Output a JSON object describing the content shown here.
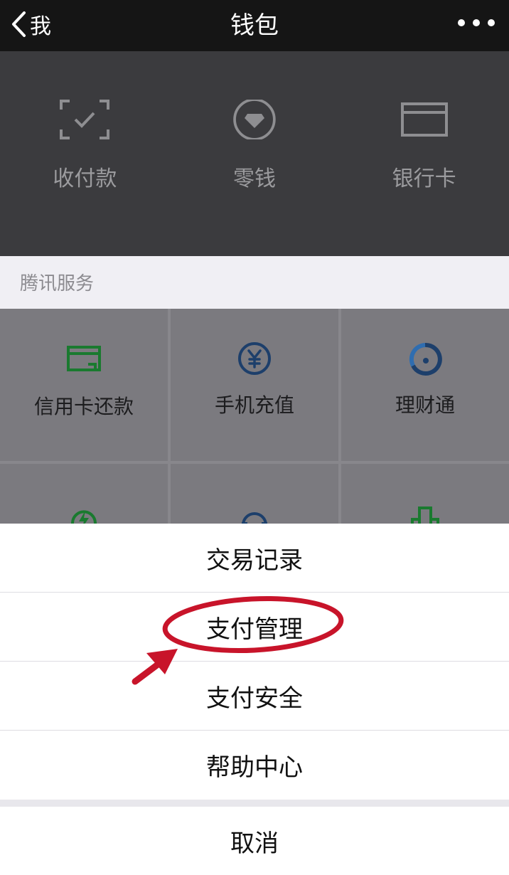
{
  "navbar": {
    "back_label": "我",
    "title": "钱包"
  },
  "wallet": [
    {
      "label": "收付款",
      "icon": "scan-pay-icon"
    },
    {
      "label": "零钱",
      "icon": "diamond-icon"
    },
    {
      "label": "银行卡",
      "icon": "bank-card-icon"
    }
  ],
  "services": {
    "section_title": "腾讯服务",
    "items": [
      {
        "label": "信用卡还款",
        "icon": "credit-card-icon"
      },
      {
        "label": "手机充值",
        "icon": "yen-icon"
      },
      {
        "label": "理财通",
        "icon": "wealth-icon"
      }
    ]
  },
  "action_sheet": {
    "items": [
      "交易记录",
      "支付管理",
      "支付安全",
      "帮助中心"
    ],
    "cancel": "取消",
    "highlighted_item": "支付管理"
  },
  "colors": {
    "accent_green": "#1aad19",
    "annotation_red": "#c8142a"
  }
}
